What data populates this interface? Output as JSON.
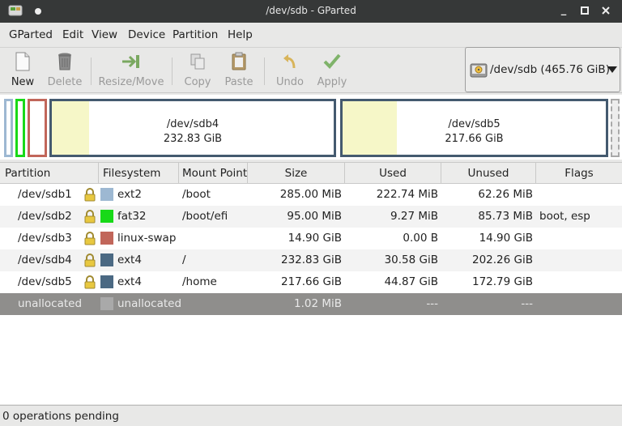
{
  "window": {
    "title": "/dev/sdb - GParted",
    "minimize": "_",
    "maximize": "□",
    "close": "✕"
  },
  "menu": {
    "items": [
      {
        "label": "GParted"
      },
      {
        "label": "Edit"
      },
      {
        "label": "View"
      },
      {
        "label": "Device"
      },
      {
        "label": "Partition"
      },
      {
        "label": "Help"
      }
    ]
  },
  "toolbar": {
    "new": "New",
    "delete": "Delete",
    "resize": "Resize/Move",
    "copy": "Copy",
    "paste": "Paste",
    "undo": "Undo",
    "apply": "Apply"
  },
  "device": {
    "selected": "/dev/sdb  (465.76 GiB)"
  },
  "partition_map": {
    "sdb4": {
      "name": "/dev/sdb4",
      "size": "232.83 GiB",
      "used_fraction": 0.131
    },
    "sdb5": {
      "name": "/dev/sdb5",
      "size": "217.66 GiB",
      "used_fraction": 0.206
    }
  },
  "table": {
    "headers": [
      "Partition",
      "Filesystem",
      "Mount Point",
      "Size",
      "Used",
      "Unused",
      "Flags"
    ],
    "rows": [
      {
        "partition": "/dev/sdb1",
        "filesystem": "ext2",
        "fs_color": "#9db8d2",
        "mount": "/boot",
        "size": "285.00 MiB",
        "used": "222.74 MiB",
        "unused": "62.26 MiB",
        "flags": "",
        "locked": true
      },
      {
        "partition": "/dev/sdb2",
        "filesystem": "fat32",
        "fs_color": "#18d918",
        "mount": "/boot/efi",
        "size": "95.00 MiB",
        "used": "9.27 MiB",
        "unused": "85.73 MiB",
        "flags": "boot, esp",
        "locked": true
      },
      {
        "partition": "/dev/sdb3",
        "filesystem": "linux-swap",
        "fs_color": "#c1665a",
        "mount": "",
        "size": "14.90 GiB",
        "used": "0.00 B",
        "unused": "14.90 GiB",
        "flags": "",
        "locked": true
      },
      {
        "partition": "/dev/sdb4",
        "filesystem": "ext4",
        "fs_color": "#4b6983",
        "mount": "/",
        "size": "232.83 GiB",
        "used": "30.58 GiB",
        "unused": "202.26 GiB",
        "flags": "",
        "locked": true
      },
      {
        "partition": "/dev/sdb5",
        "filesystem": "ext4",
        "fs_color": "#4b6983",
        "mount": "/home",
        "size": "217.66 GiB",
        "used": "44.87 GiB",
        "unused": "172.79 GiB",
        "flags": "",
        "locked": true
      },
      {
        "partition": "unallocated",
        "filesystem": "unallocated",
        "fs_color": "#a9a9a9",
        "mount": "",
        "size": "1.02 MiB",
        "used": "---",
        "unused": "---",
        "flags": "",
        "locked": false
      }
    ]
  },
  "status": {
    "text": "0 operations pending"
  },
  "colors": {
    "titlebar": "#363838",
    "partition_border": "#445a6f",
    "used_fill": "#f6f7c8",
    "selected_row": "#8f8e8c"
  }
}
